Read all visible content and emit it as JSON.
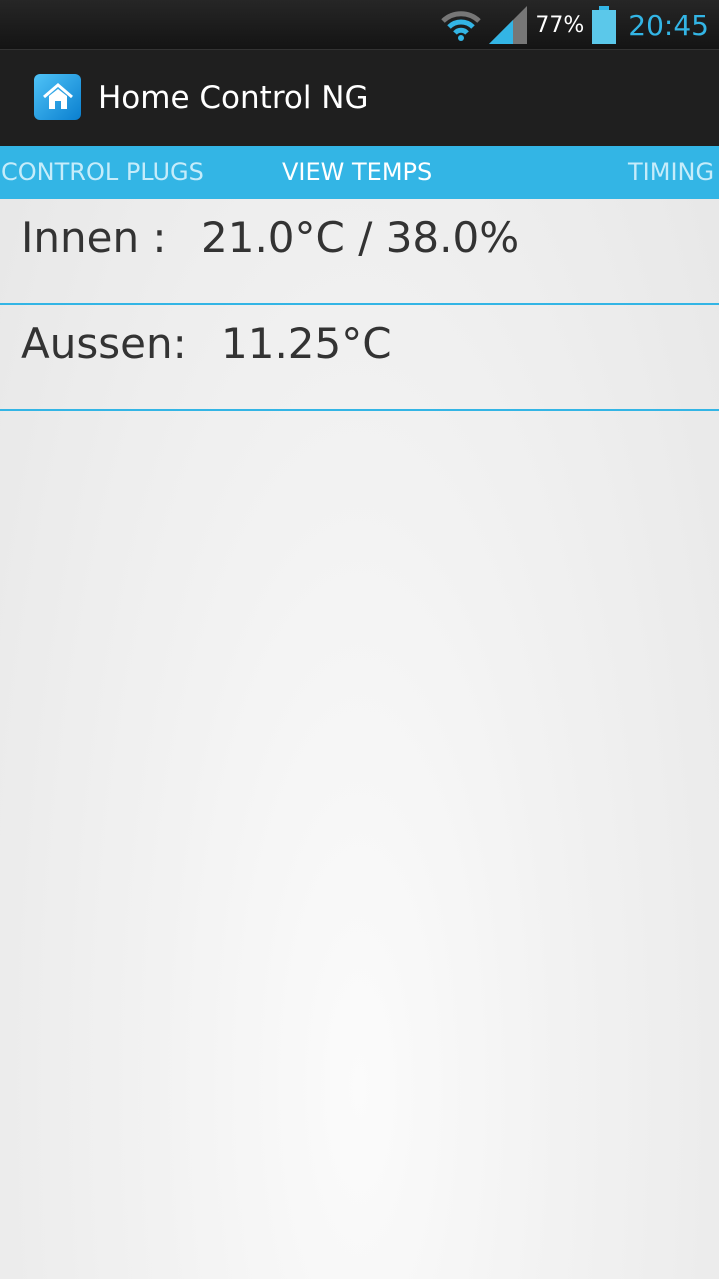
{
  "status_bar": {
    "battery_percent": "77%",
    "time": "20:45",
    "battery_level": 77,
    "accent": "#33b5e5"
  },
  "action_bar": {
    "title": "Home Control NG",
    "icon": "home-icon"
  },
  "tabs": [
    {
      "label": "CONTROL PLUGS"
    },
    {
      "label": "VIEW TEMPS",
      "selected": true
    },
    {
      "label": "TIMING"
    }
  ],
  "readings": [
    {
      "label": "Innen :",
      "value": "21.0°C / 38.0%"
    },
    {
      "label": "Aussen:",
      "value": "11.25°C"
    }
  ]
}
